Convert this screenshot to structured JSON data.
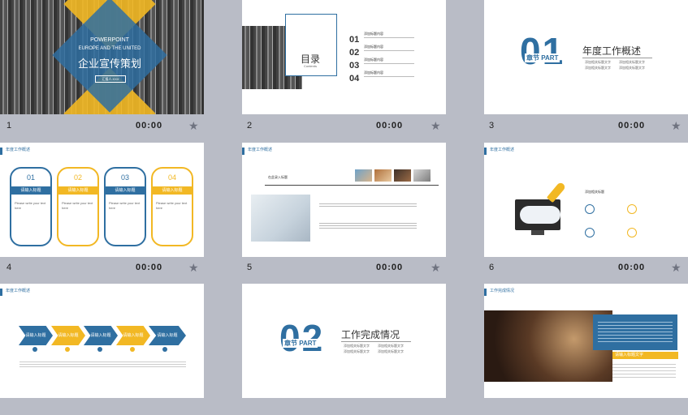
{
  "slides": [
    {
      "num": "1",
      "time": "00:00",
      "title_en1": "POWERPOINT",
      "title_en2": "EUROPE AND THE UNITED",
      "title_cn": "企业宣传策划",
      "tag": "汇报人:XXX"
    },
    {
      "num": "2",
      "time": "00:00",
      "toc_title": "目录",
      "toc_sub": "Contents",
      "items": [
        {
          "n": "01",
          "t": "添加标题内容"
        },
        {
          "n": "02",
          "t": "添加标题内容"
        },
        {
          "n": "03",
          "t": "添加标题内容"
        },
        {
          "n": "04",
          "t": "添加标题内容"
        }
      ]
    },
    {
      "num": "3",
      "time": "00:00",
      "big": "01",
      "chapter": "章节 PART",
      "title": "年度工作概述",
      "bullets": [
        "添加相关标题文字",
        "添加相关标题文字",
        "添加相关标题文字",
        "添加相关标题文字"
      ]
    },
    {
      "num": "4",
      "time": "00:00",
      "header": "年度工作概述",
      "cards": [
        {
          "n": "01",
          "label": "请输入标题",
          "color": "#2f6fa1"
        },
        {
          "n": "02",
          "label": "请输入标题",
          "color": "#f2b824"
        },
        {
          "n": "03",
          "label": "请输入标题",
          "color": "#2f6fa1"
        },
        {
          "n": "04",
          "label": "请输入标题",
          "color": "#f2b824"
        }
      ],
      "card_text": "Please write your text here"
    },
    {
      "num": "5",
      "time": "00:00",
      "header": "年度工作概述",
      "label": "在此录入标题"
    },
    {
      "num": "6",
      "time": "00:00",
      "header": "年度工作概述",
      "label": "添加相关标题"
    },
    {
      "num": "7",
      "time": "00:00",
      "header": "年度工作概述",
      "arrows": [
        {
          "label": "请输入标题",
          "color": "#2f6fa1"
        },
        {
          "label": "请输入标题",
          "color": "#f2b824"
        },
        {
          "label": "请输入标题",
          "color": "#2f6fa1"
        },
        {
          "label": "请输入标题",
          "color": "#f2b824"
        },
        {
          "label": "请输入标题",
          "color": "#2f6fa1"
        }
      ]
    },
    {
      "num": "8",
      "time": "00:00",
      "big": "02",
      "chapter": "章节 PART",
      "title": "工作完成情况",
      "bullets": [
        "添加相关标题文字",
        "添加相关标题文字",
        "添加相关标题文字",
        "添加相关标题文字"
      ]
    },
    {
      "num": "9",
      "time": "00:00",
      "header": "工作完成情况",
      "tag": "请输入标题文字"
    }
  ],
  "colors": {
    "blue": "#2f6fa1",
    "yellow": "#f2b824",
    "bg": "#b9bcc6"
  }
}
